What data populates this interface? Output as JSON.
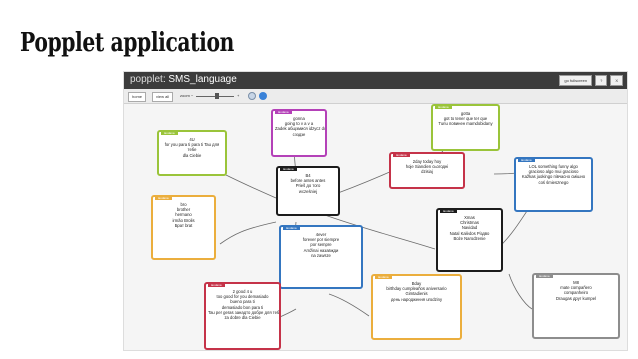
{
  "slide": {
    "title": "Popplet application"
  },
  "app": {
    "logo": "popplet",
    "file_name": "SMS_language",
    "buttons": {
      "fullscreen": "go fullscreen",
      "help": "?",
      "close": "X"
    }
  },
  "toolbar": {
    "home": "home",
    "view_all": "view all",
    "zoom_label": "zoom",
    "zoom_minus": "−",
    "zoom_plus": "+",
    "zoom_level": 0.55
  },
  "colors": {
    "purple": "#b441b8",
    "green": "#9ac43a",
    "red": "#c53349",
    "black": "#1c1c1c",
    "blue": "#3476c0",
    "orange": "#ebae3d",
    "gray": "#8d8d8d",
    "toolbar": "#3c3c3c"
  },
  "nodes": [
    {
      "id": "n1",
      "color": "purple",
      "tag": "lavdana",
      "lines": [
        "gonna",
        "going to    v a    v a",
        "Zadek  абщэмися    idzycz do",
        "сэздзе"
      ]
    },
    {
      "id": "n2",
      "color": "green",
      "tag": "lavdana",
      "lines": [
        "gotta",
        "got to  tener que    ter que",
        "Turiu   повинен    mamdobidany"
      ]
    },
    {
      "id": "n3",
      "color": "green",
      "tag": "lavdana",
      "lines": [
        "4U",
        "for you  para ti  para ti    Tau     для",
        "тебе",
        "dla Ciebie"
      ]
    },
    {
      "id": "n4",
      "color": "red",
      "tag": "lavdana",
      "lines": [
        "2day  today  hoy",
        "hoje     Siandien  сьогодні",
        "dzisiaj"
      ]
    },
    {
      "id": "n5",
      "color": "black",
      "tag": "lavdana",
      "lines": [
        "B4",
        "before  antes     antes",
        "Prieš   до того",
        "wcześniej"
      ]
    },
    {
      "id": "n6",
      "color": "blue",
      "tag": "lavdana",
      "lines": [
        "LOL      something funny    algo",
        "gracioso  algo mui gracioso",
        "Kažkas juokingo  півчасно смішно",
        "coś śmiesznego"
      ]
    },
    {
      "id": "n7",
      "color": "orange",
      "tag": "lavdana",
      "lines": [
        "bro",
        "brother",
        "hermano",
        "irmão  Brolis",
        "Брат    brat"
      ]
    },
    {
      "id": "n8",
      "color": "blue",
      "tag": "lavdana",
      "lines": [
        "4ever",
        "forever  por siempre",
        "por sempre",
        "Amžinai         назавжди",
        "na zawsze"
      ]
    },
    {
      "id": "n9",
      "color": "black",
      "tag": "lavdana",
      "lines": [
        "Xmas",
        "Christmas",
        "Navidad",
        "Natal       Kalėdos  Різдво",
        "Boże Narodzenie"
      ]
    },
    {
      "id": "n10",
      "color": "red",
      "tag": "lavdana",
      "lines": [
        "2 good 4 u",
        "too good for you    demasiado",
        "bueno para ti",
        "demasiado bon para ti",
        "Tau per geras        занадто добре для тебе",
        "za dobre dla Ciebie"
      ]
    },
    {
      "id": "n11",
      "color": "orange",
      "tag": "lavdana",
      "lines": [
        "Bday",
        "birthday cumpleaños    aniversario",
        "Gimtadienis",
        "день народження  urodziny"
      ]
    },
    {
      "id": "n12",
      "color": "gray",
      "tag": "lavdana",
      "lines": [
        "M8",
        "mate   compañero",
        "companheiro",
        "Draugas  друг  kumpel"
      ]
    }
  ]
}
